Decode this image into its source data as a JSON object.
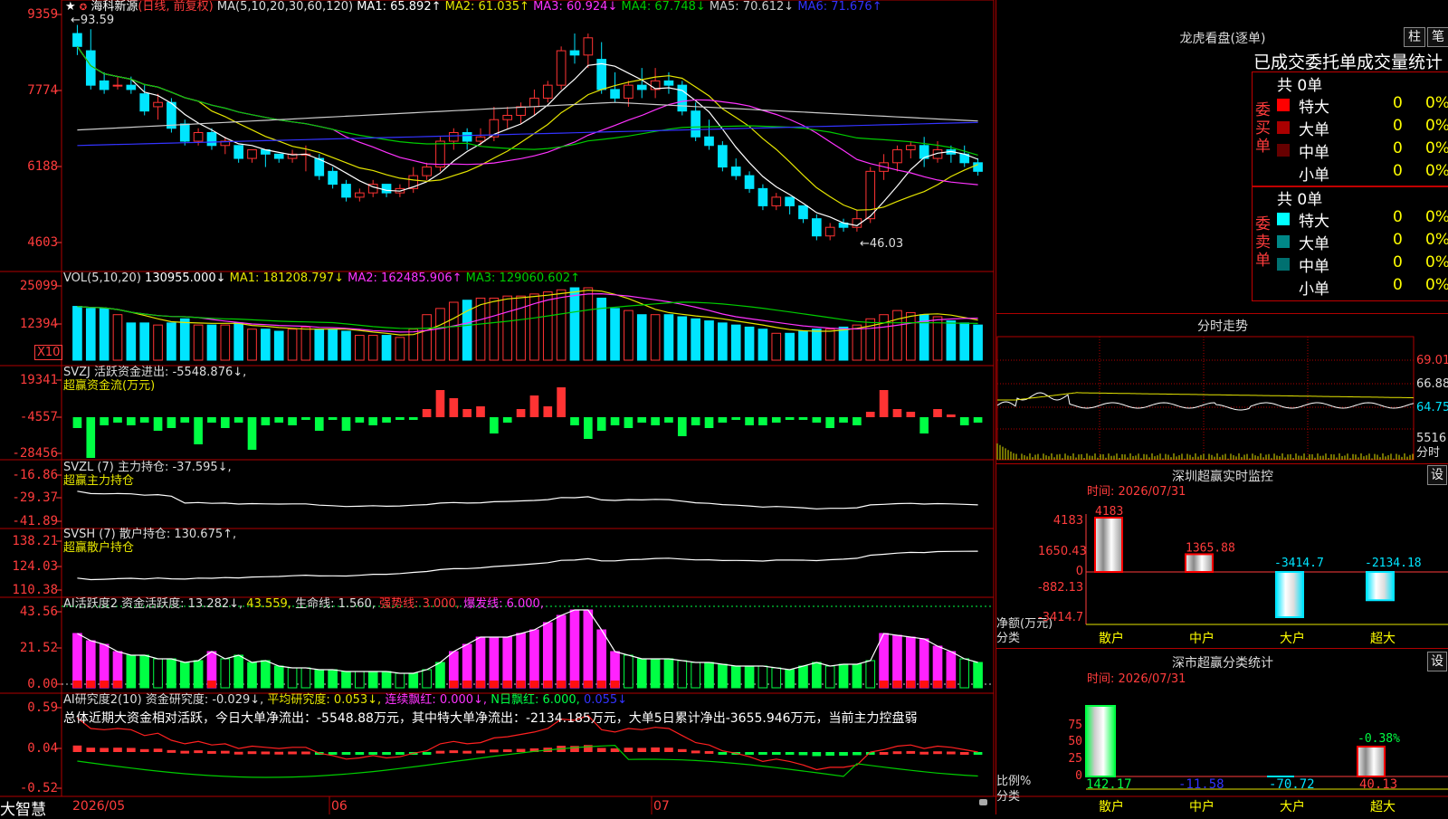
{
  "app": {
    "brand": "大智慧"
  },
  "stock": {
    "name": "海科新源",
    "mode": "(日线, 前复权)",
    "fav_icon": "★",
    "fav_icon2": "✪"
  },
  "colors": {
    "up": "#ff3333",
    "down": "#00e5ff",
    "ma1": "#ffffff",
    "ma2": "#e5e500",
    "ma3": "#ff33ff",
    "ma4": "#00cc00",
    "ma5": "#cccccc",
    "ma6": "#3333ff",
    "grid": "#b00000",
    "axis": "#ff3c3c",
    "green": "#00ff44",
    "magenta": "#ff22ff"
  },
  "price_panel": {
    "ma_label": "MA(5,10,20,30,60,120)",
    "ma1": "MA1: 65.892↑",
    "ma2": "MA2: 61.035↑",
    "ma3": "MA3: 60.924↓",
    "ma4": "MA4: 67.748↓",
    "ma5": "MA5: 70.612↓",
    "ma6": "MA6: 71.676↑",
    "y_labels": [
      "9359",
      "7774",
      "6188",
      "4603"
    ],
    "high_note": "←93.59",
    "low_note": "←46.03"
  },
  "vol_panel": {
    "label": "VOL(5,10,20)",
    "value": "130955.000↓",
    "ma1": "MA1: 181208.797↓",
    "ma2": "MA2: 162485.906↑",
    "ma3": "MA3: 129060.602↑",
    "y_labels": [
      "25099",
      "12394"
    ],
    "unit": "X10"
  },
  "svzj_panel": {
    "label": "SVZJ  活跃资金进出: -5548.876↓,",
    "sub": "超赢资金流(万元)",
    "y_labels": [
      "19341",
      "-4557",
      "-28456"
    ]
  },
  "svzl_panel": {
    "label": "SVZL (7) 主力持仓: -37.595↓,",
    "sub": "超赢主力持仓",
    "y_labels": [
      "-16.86",
      "-29.37",
      "-41.89"
    ]
  },
  "svsh_panel": {
    "label": "SVSH (7) 散户持仓: 130.675↑,",
    "sub": "超赢散户持仓",
    "y_labels": [
      "138.21",
      "124.03",
      "110.38"
    ]
  },
  "ai_panel": {
    "label": "AI活跃度2 资金活跃度: 13.282↓,",
    "v2": "43.559,",
    "v3": "生命线: 1.560,",
    "v4": "强势线: 3.000,",
    "v5": "爆发线: 6.000,",
    "y_labels": [
      "43.56",
      "21.52",
      "0.00"
    ]
  },
  "ai2_panel": {
    "label": "AI研究度2(10) 资金研究度: -0.029↓,",
    "v2": "平均研究度: 0.053↓,",
    "v3": "连续飘红: 0.000↓,",
    "v4": "N日飘红: 6.000,",
    "v5": "0.055↓",
    "summary": "总体近期大资金相对活跃，今日大单净流出：-5548.88万元，其中特大单净流出：-2134.185万元，大单5日累计净出-3655.946万元，当前主力控盘弱",
    "y_labels": [
      "0.59",
      "0.04",
      "-0.52"
    ]
  },
  "x_axis": {
    "labels": [
      "2026/05",
      "06",
      "07"
    ]
  },
  "right": {
    "lhb_title": "龙虎看盘(逐单)",
    "btn1": "柱",
    "btn2": "笔",
    "stat_title": "已成交委托单成交量统计",
    "buy_side": "委买单",
    "sell_side": "委卖单",
    "buy_total": "共 0单",
    "sell_total": "共 0单",
    "buy_rows": [
      {
        "label": "特大",
        "count": "0",
        "pct": "0%",
        "color": "#ff0000"
      },
      {
        "label": "大单",
        "count": "0",
        "pct": "0%",
        "color": "#aa0000"
      },
      {
        "label": "中单",
        "count": "0",
        "pct": "0%",
        "color": "#660000"
      },
      {
        "label": "小单",
        "count": "0",
        "pct": "0%",
        "color": "#000000"
      }
    ],
    "sell_rows": [
      {
        "label": "特大",
        "count": "0",
        "pct": "0%",
        "color": "#00ffff"
      },
      {
        "label": "大单",
        "count": "0",
        "pct": "0%",
        "color": "#008888"
      },
      {
        "label": "中单",
        "count": "0",
        "pct": "0%",
        "color": "#007070"
      },
      {
        "label": "小单",
        "count": "0",
        "pct": "0%",
        "color": "#000000"
      }
    ],
    "intraday_title": "分时走势",
    "intraday_prices": [
      "69.01",
      "66.88",
      "64.75"
    ],
    "intraday_vol": "5516",
    "intraday_unit": "分时",
    "sz_title": "深圳超赢实时监控",
    "sz_time": "时间: 2026/07/31",
    "sz_btn": "设",
    "sz_y_labels": [
      "4183",
      "1650.43",
      "0",
      "-882.13",
      "-3414.7"
    ],
    "sz_bars": [
      {
        "cat": "散户",
        "value": 4183,
        "label": "4183"
      },
      {
        "cat": "中户",
        "value": 1365.88,
        "label": "1365.88"
      },
      {
        "cat": "大户",
        "value": -3414.7,
        "label": "-3414.7"
      },
      {
        "cat": "超大",
        "value": -2134.18,
        "label": "-2134.18"
      }
    ],
    "sz_axis_label": "净额(万元)",
    "sz_cat_label": "分类",
    "cls_title": "深市超赢分类统计",
    "cls_time": "时间: 2026/07/31",
    "cls_btn": "设",
    "cls_y_labels": [
      "75",
      "50",
      "25",
      "0"
    ],
    "cls_top_label": "-0.38%",
    "cls_values": [
      "142.17",
      "-11.58",
      "-70.72",
      "40.13"
    ],
    "cls_cats": [
      "散户",
      "中户",
      "大户",
      "超大"
    ],
    "cls_axis_label": "比例%",
    "cls_cat_label": "分类"
  },
  "chart_data": [
    {
      "type": "candlestick",
      "title": "海科新源(日线, 前复权)",
      "y_ticks": [
        9359,
        7774,
        6188,
        4603
      ],
      "high": 93.59,
      "low": 46.03,
      "series": [
        {
          "name": "MA1",
          "last": 65.892
        },
        {
          "name": "MA2",
          "last": 61.035
        },
        {
          "name": "MA3",
          "last": 60.924
        },
        {
          "name": "MA4",
          "last": 67.748
        },
        {
          "name": "MA5",
          "last": 70.612
        },
        {
          "name": "MA6",
          "last": 71.676
        }
      ],
      "candles": [
        [
          92,
          94,
          89,
          87
        ],
        [
          88,
          93,
          80,
          79
        ],
        [
          81,
          83,
          79,
          78
        ],
        [
          80,
          82,
          80,
          79
        ],
        [
          80,
          82,
          79,
          78
        ],
        [
          78,
          80,
          74,
          73
        ],
        [
          75,
          78,
          76,
          72
        ],
        [
          76,
          77,
          70,
          69
        ],
        [
          71,
          72,
          67,
          66
        ],
        [
          67,
          70,
          69,
          66
        ],
        [
          69,
          70,
          66,
          65
        ],
        [
          66,
          68,
          67,
          64
        ],
        [
          66,
          66,
          63,
          62
        ],
        [
          63,
          65,
          65,
          62
        ],
        [
          65,
          65,
          64,
          61
        ],
        [
          64,
          64,
          63,
          62
        ],
        [
          63,
          65,
          64,
          62
        ],
        [
          64,
          66,
          64,
          60
        ],
        [
          63,
          64,
          59,
          58
        ],
        [
          60,
          61,
          57,
          56
        ],
        [
          57,
          58,
          54,
          53
        ],
        [
          54,
          56,
          55,
          53
        ],
        [
          55,
          58,
          57,
          54
        ],
        [
          57,
          57,
          55,
          54
        ],
        [
          55,
          57,
          56,
          54
        ],
        [
          56,
          61,
          59,
          55
        ],
        [
          59,
          62,
          61,
          58
        ],
        [
          61,
          68,
          67,
          60
        ],
        [
          67,
          70,
          69,
          65
        ],
        [
          69,
          70,
          67,
          65
        ],
        [
          67,
          70,
          68,
          66
        ],
        [
          68,
          75,
          72,
          67
        ],
        [
          72,
          75,
          73,
          70
        ],
        [
          73,
          76,
          75,
          71
        ],
        [
          75,
          79,
          77,
          73
        ],
        [
          77,
          81,
          80,
          76
        ],
        [
          80,
          89,
          88,
          79
        ],
        [
          88,
          92,
          87,
          85
        ],
        [
          87,
          92,
          91,
          84
        ],
        [
          86,
          90,
          79,
          78
        ],
        [
          79,
          83,
          77,
          76
        ],
        [
          77,
          81,
          80,
          75
        ],
        [
          80,
          84,
          79,
          77
        ],
        [
          79,
          84,
          81,
          77
        ],
        [
          81,
          83,
          80,
          78
        ],
        [
          80,
          81,
          74,
          73
        ],
        [
          74,
          76,
          68,
          67
        ],
        [
          68,
          72,
          66,
          65
        ],
        [
          66,
          67,
          61,
          60
        ],
        [
          61,
          63,
          59,
          58
        ],
        [
          59,
          60,
          56,
          55
        ],
        [
          56,
          57,
          52,
          51
        ],
        [
          52,
          55,
          54,
          51
        ],
        [
          54,
          54,
          52,
          50
        ],
        [
          52,
          52,
          49,
          48
        ],
        [
          49,
          50,
          45,
          44
        ],
        [
          45,
          48,
          47,
          44
        ],
        [
          48,
          49,
          47,
          46
        ],
        [
          47,
          51,
          49,
          46
        ],
        [
          49,
          61,
          60,
          48
        ],
        [
          60,
          64,
          62,
          58
        ],
        [
          62,
          66,
          65,
          60
        ],
        [
          65,
          67,
          66,
          63
        ],
        [
          66,
          68,
          63,
          61
        ],
        [
          63,
          67,
          65,
          62
        ],
        [
          65,
          66,
          64,
          62
        ],
        [
          64,
          66,
          62,
          61
        ],
        [
          62,
          63,
          60,
          59
        ]
      ]
    },
    {
      "type": "bar",
      "title": "VOL(5,10,20)",
      "y_ticks": [
        25099,
        12394
      ],
      "unit": "X10",
      "values": [
        26,
        25,
        25,
        22,
        18,
        18,
        17,
        18,
        20,
        17,
        17,
        17,
        18,
        15,
        15,
        14,
        15,
        16,
        15,
        15,
        14,
        12,
        12,
        12,
        11,
        15,
        22,
        25,
        28,
        29,
        30,
        30,
        31,
        31,
        32,
        33,
        34,
        35,
        35,
        30,
        25,
        24,
        22,
        22,
        22,
        21,
        20,
        19,
        18,
        17,
        16,
        15,
        13,
        13,
        14,
        15,
        15,
        16,
        17,
        20,
        22,
        24,
        23,
        22,
        21,
        19,
        18,
        17
      ]
    },
    {
      "type": "bar",
      "title": "SVZJ 活跃资金进出",
      "last": -5548.876,
      "y_ticks": [
        19341,
        -4557,
        -28456
      ],
      "values": [
        -4,
        -15,
        -3,
        -2,
        -3,
        -2,
        -5,
        -4,
        -2,
        -10,
        -2,
        -4,
        -2,
        -12,
        -3,
        -2,
        -3,
        -1,
        -5,
        -1,
        -5,
        -2,
        -3,
        -2,
        -1,
        -1,
        3,
        10,
        7,
        3,
        4,
        -6,
        -2,
        3,
        8,
        4,
        11,
        -3,
        -8,
        -5,
        -3,
        -4,
        -2,
        -3,
        -2,
        -7,
        -3,
        -4,
        -2,
        -1,
        -3,
        -3,
        -2,
        -1,
        -1,
        -2,
        -4,
        -2,
        -3,
        2,
        10,
        3,
        2,
        -6,
        3,
        1,
        -3,
        -2
      ]
    },
    {
      "type": "line",
      "title": "SVZL (7) 主力持仓",
      "last": -37.595,
      "y_ticks": [
        -16.86,
        -29.37,
        -41.89
      ]
    },
    {
      "type": "line",
      "title": "SVSH (7) 散户持仓",
      "last": 130.675,
      "y_ticks": [
        138.21,
        124.03,
        110.38
      ]
    },
    {
      "type": "bar",
      "title": "AI活跃度2 资金活跃度",
      "last": 13.282,
      "y_ticks": [
        43.56,
        21.52,
        0.0
      ],
      "values": [
        30,
        26,
        24,
        20,
        18,
        18,
        16,
        16,
        14,
        15,
        20,
        16,
        18,
        14,
        15,
        12,
        11,
        11,
        10,
        10,
        9,
        9,
        9,
        9,
        8,
        8,
        10,
        14,
        20,
        24,
        28,
        28,
        28,
        30,
        32,
        36,
        40,
        43,
        43,
        32,
        20,
        18,
        16,
        16,
        16,
        15,
        14,
        14,
        13,
        12,
        12,
        12,
        11,
        10,
        12,
        14,
        12,
        13,
        13,
        15,
        30,
        29,
        28,
        27,
        23,
        20,
        16,
        14
      ]
    },
    {
      "type": "bar",
      "title": "AI研究度2(10) 资金研究度",
      "last": -0.029,
      "y_ticks": [
        0.59,
        0.04,
        -0.52
      ]
    }
  ]
}
